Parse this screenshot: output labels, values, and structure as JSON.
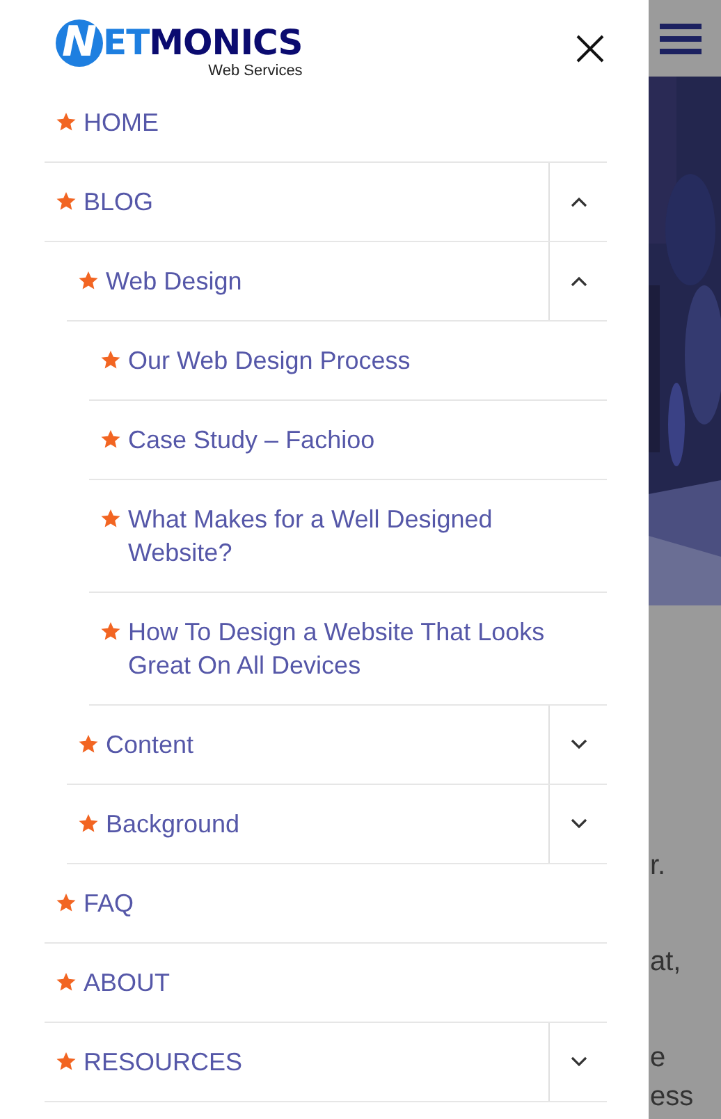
{
  "logo": {
    "mark": "N",
    "accent": "ET",
    "name": "MONICS",
    "tagline": "Web Services"
  },
  "menu": {
    "items": [
      {
        "label": "HOME"
      },
      {
        "label": "BLOG",
        "expanded": true,
        "children": [
          {
            "label": "Web Design",
            "expanded": true,
            "children": [
              {
                "label": "Our Web Design Process"
              },
              {
                "label": "Case Study – Fachioo"
              },
              {
                "label": "What Makes for a Well Designed Website?"
              },
              {
                "label": "How To Design a Website That Looks Great On All Devices"
              }
            ]
          },
          {
            "label": "Content",
            "expanded": false
          },
          {
            "label": "Background",
            "expanded": false
          }
        ]
      },
      {
        "label": "FAQ"
      },
      {
        "label": "ABOUT"
      },
      {
        "label": "RESOURCES",
        "expanded": false
      }
    ]
  },
  "background_page": {
    "paragraphs": [
      [
        "r."
      ],
      [
        "at,"
      ],
      [
        "e",
        "ess"
      ]
    ]
  }
}
